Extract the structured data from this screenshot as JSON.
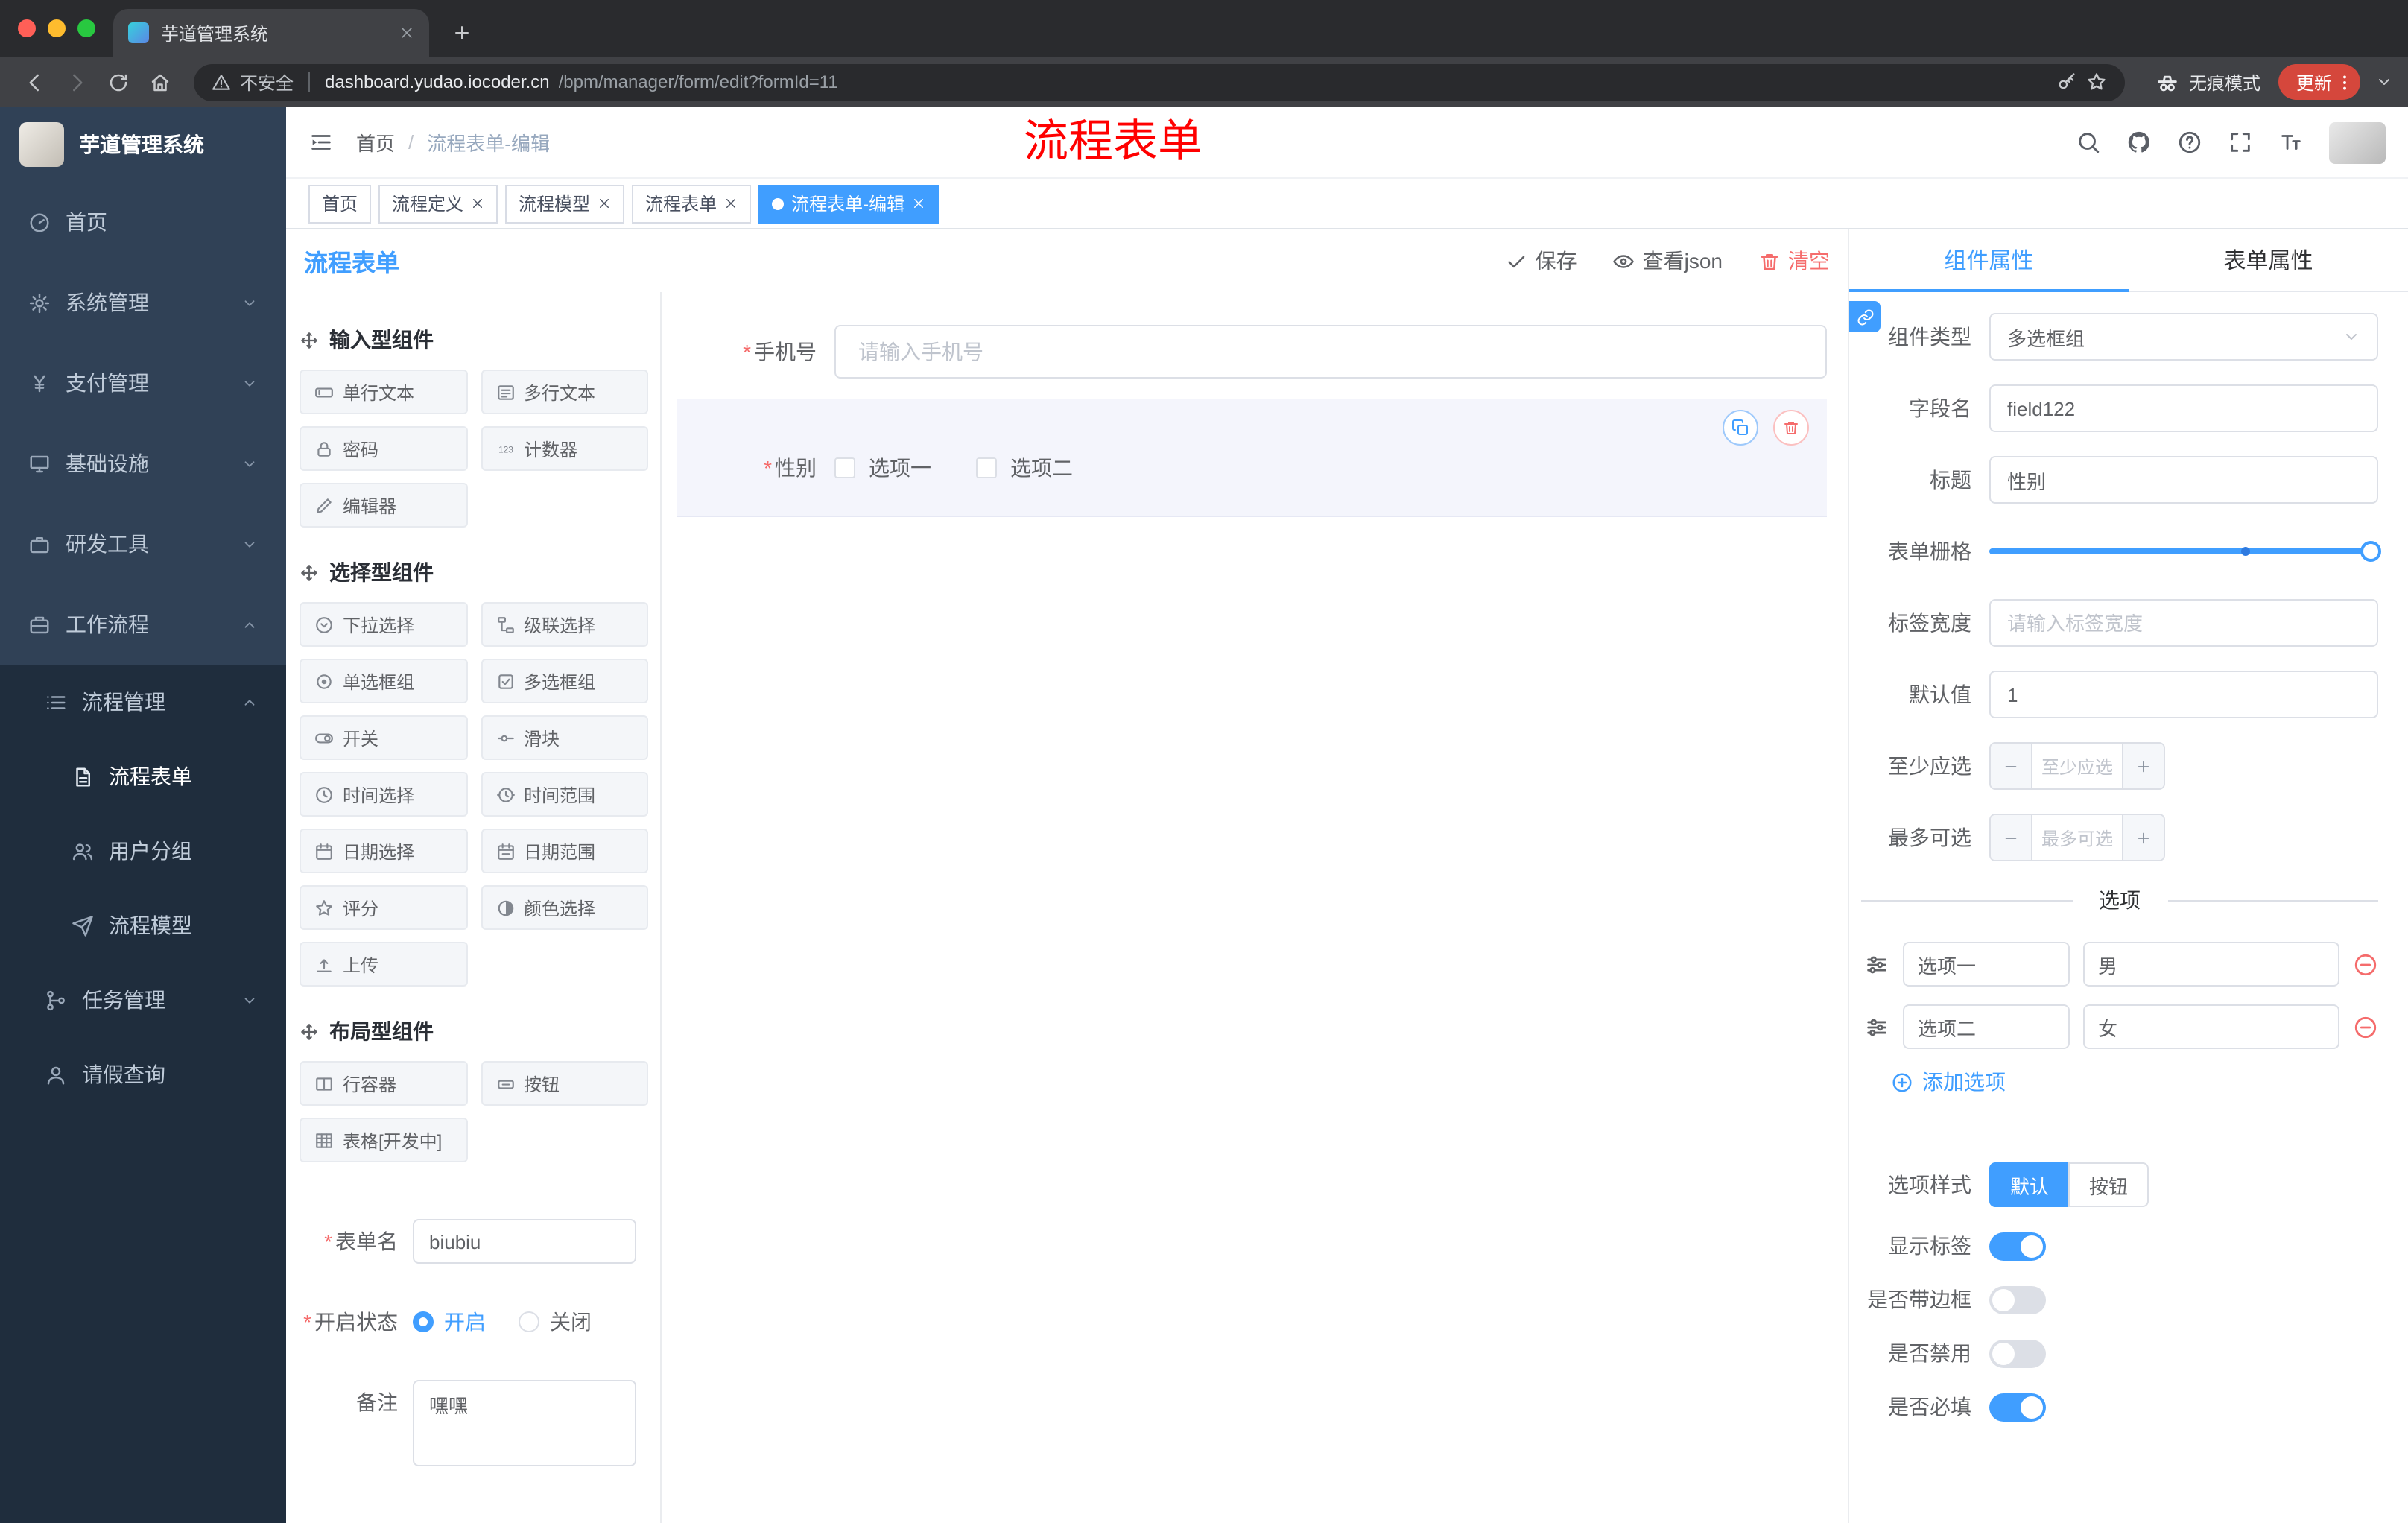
{
  "browser": {
    "tab_title": "芋道管理系统",
    "security_label": "不安全",
    "url_host": "dashboard.yudao.iocoder.cn",
    "url_path": "/bpm/manager/form/edit?formId=11",
    "incognito_label": "无痕模式",
    "update_label": "更新"
  },
  "annotation_text": "流程表单",
  "misc": {
    "required_marker": "*",
    "breadcrumb_separator": "/"
  },
  "sidebar": {
    "logo_title": "芋道管理系统",
    "items": [
      {
        "icon": "dashboard-icon",
        "label": "首页"
      },
      {
        "icon": "gear-icon",
        "label": "系统管理"
      },
      {
        "icon": "yen-icon",
        "label": "支付管理"
      },
      {
        "icon": "monitor-icon",
        "label": "基础设施"
      },
      {
        "icon": "briefcase-icon",
        "label": "研发工具"
      },
      {
        "icon": "workflow-icon",
        "label": "工作流程"
      },
      {
        "icon": "list-icon",
        "label": "流程管理"
      },
      {
        "icon": "document-icon",
        "label": "流程表单"
      },
      {
        "icon": "users-icon",
        "label": "用户分组"
      },
      {
        "icon": "send-icon",
        "label": "流程模型"
      },
      {
        "icon": "branch-icon",
        "label": "任务管理"
      },
      {
        "icon": "user-icon",
        "label": "请假查询"
      }
    ]
  },
  "header": {
    "breadcrumb_home": "首页",
    "breadcrumb_current": "流程表单-编辑"
  },
  "tags": [
    {
      "label": "首页"
    },
    {
      "label": "流程定义"
    },
    {
      "label": "流程模型"
    },
    {
      "label": "流程表单"
    },
    {
      "label": "流程表单-编辑"
    }
  ],
  "designer": {
    "title": "流程表单",
    "save_label": "保存",
    "view_json_label": "查看json",
    "clear_label": "清空",
    "sections": [
      {
        "title": "输入型组件",
        "items": [
          {
            "icon": "input-icon",
            "label": "单行文本"
          },
          {
            "icon": "textarea-icon",
            "label": "多行文本"
          },
          {
            "icon": "lock-icon",
            "label": "密码"
          },
          {
            "icon": "counter-icon",
            "label": "计数器"
          },
          {
            "icon": "editor-icon",
            "label": "编辑器"
          }
        ]
      },
      {
        "title": "选择型组件",
        "items": [
          {
            "icon": "select-icon",
            "label": "下拉选择"
          },
          {
            "icon": "cascade-icon",
            "label": "级联选择"
          },
          {
            "icon": "radio-icon",
            "label": "单选框组"
          },
          {
            "icon": "checkbox-icon",
            "label": "多选框组"
          },
          {
            "icon": "switch-icon",
            "label": "开关"
          },
          {
            "icon": "slider-icon",
            "label": "滑块"
          },
          {
            "icon": "time-icon",
            "label": "时间选择"
          },
          {
            "icon": "time-range-icon",
            "label": "时间范围"
          },
          {
            "icon": "date-icon",
            "label": "日期选择"
          },
          {
            "icon": "date-range-icon",
            "label": "日期范围"
          },
          {
            "icon": "star-icon",
            "label": "评分"
          },
          {
            "icon": "color-icon",
            "label": "颜色选择"
          },
          {
            "icon": "upload-icon",
            "label": "上传"
          }
        ]
      },
      {
        "title": "布局型组件",
        "items": [
          {
            "icon": "row-icon",
            "label": "行容器"
          },
          {
            "icon": "button-icon",
            "label": "按钮"
          },
          {
            "icon": "table-icon",
            "label": "表格[开发中]"
          }
        ]
      }
    ],
    "form_config": {
      "name_label": "表单名",
      "name_value": "biubiu",
      "status_label": "开启状态",
      "status_on": "开启",
      "status_off": "关闭",
      "remark_label": "备注",
      "remark_value": "嘿嘿"
    },
    "canvas": {
      "phone_label": "手机号",
      "phone_placeholder": "请输入手机号",
      "gender_label": "性别",
      "gender_option1": "选项一",
      "gender_option2": "选项二"
    }
  },
  "props": {
    "tab_component": "组件属性",
    "tab_form": "表单属性",
    "type_label": "组件类型",
    "type_value": "多选框组",
    "field_label": "字段名",
    "field_value": "field122",
    "title_label": "标题",
    "title_value": "性别",
    "grid_label": "表单栅格",
    "width_label": "标签宽度",
    "width_placeholder": "请输入标签宽度",
    "default_label": "默认值",
    "default_value": "1",
    "min_label": "至少应选",
    "min_placeholder": "至少应选",
    "max_label": "最多可选",
    "max_placeholder": "最多可选",
    "options_title": "选项",
    "options": [
      {
        "label": "选项一",
        "value": "男"
      },
      {
        "label": "选项二",
        "value": "女"
      }
    ],
    "add_option_label": "添加选项",
    "style_label": "选项样式",
    "style_default": "默认",
    "style_button": "按钮",
    "show_label_label": "显示标签",
    "border_label": "是否带边框",
    "disabled_label": "是否禁用",
    "required_label": "是否必填"
  },
  "colors": {
    "accent": "#409EFF",
    "danger": "#F56C6C",
    "annotation": "#FF0000",
    "sidebar": "#304156",
    "submenu": "#1F2D3D"
  }
}
